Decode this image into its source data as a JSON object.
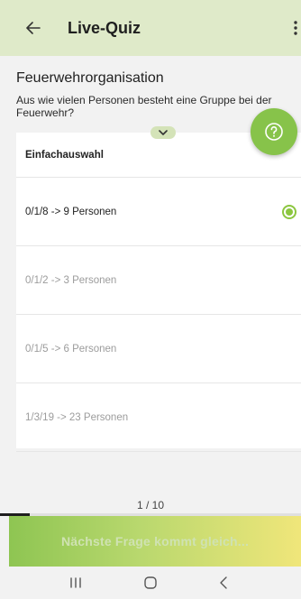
{
  "app_bar": {
    "title": "Live-Quiz",
    "back_icon": "arrow-left-icon",
    "menu_icon": "more-vertical-icon"
  },
  "question": {
    "topic": "Feuerwehrorganisation",
    "text": "Aus wie vielen Personen besteht eine Gruppe bei der Feuerwehr?"
  },
  "answer_section": {
    "label": "Einfachauswahl",
    "options": [
      {
        "label": "0/1/8 -> 9 Personen",
        "selected": true
      },
      {
        "label": "0/1/2 -> 3 Personen",
        "selected": false
      },
      {
        "label": "0/1/5 -> 6 Personen",
        "selected": false
      },
      {
        "label": "1/3/19 -> 23 Personen",
        "selected": false
      }
    ]
  },
  "help_button": {
    "icon": "help-circle-icon"
  },
  "progress": {
    "counter": "1 / 10",
    "current": 1,
    "total": 10
  },
  "next_banner": {
    "label": "Nächste Frage kommt gleich..."
  },
  "navbar": {
    "icons": [
      "recent-apps-icon",
      "home-icon",
      "back-nav-icon"
    ]
  },
  "colors": {
    "app_bar": "#dfeac9",
    "accent": "#87c34a",
    "background": "#f2f2f2"
  }
}
